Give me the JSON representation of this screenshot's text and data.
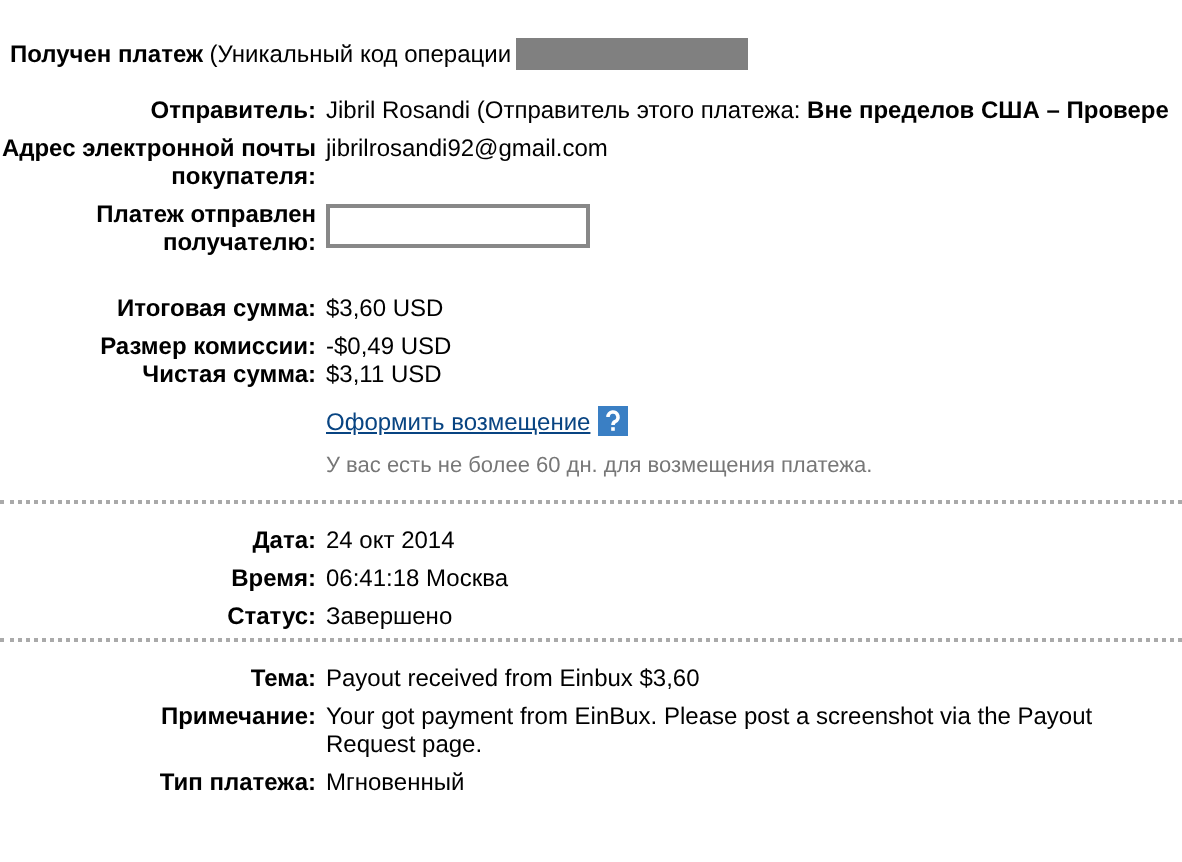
{
  "header": {
    "title": "**Получен платеж** (Уникальный код операции"
  },
  "sections": [
    {
      "rows": [
        {
          "kind": "text",
          "label": "Отправитель:",
          "value": "Jibril Rosandi (Отправитель этого платежа: **Вне пределов США – Провере**"
        },
        {
          "kind": "text",
          "label": "Адрес электронной почты покупателя:",
          "value": "jibrilrosandi92@gmail.com"
        },
        {
          "kind": "redacted",
          "label": "Платеж отправлен получателю:"
        },
        {
          "kind": "gap"
        },
        {
          "kind": "text",
          "label": "Итоговая сумма:",
          "value": "$3,60 USD"
        },
        {
          "kind": "text",
          "label": "Размер комиссии:",
          "value": "-$0,49 USD"
        },
        {
          "kind": "text",
          "label": "Чистая сумма:",
          "value": "$3,11 USD"
        },
        {
          "kind": "link",
          "value": "Оформить возмещение",
          "note": "У вас есть не более 60 дн. для возмещения платежа."
        }
      ]
    },
    {
      "rows": [
        {
          "kind": "text",
          "label": "Дата:",
          "value": "24 окт 2014"
        },
        {
          "kind": "text",
          "label": "Время:",
          "value": "06:41:18 Москва"
        },
        {
          "kind": "text",
          "label": "Статус:",
          "value": "Завершено"
        }
      ]
    },
    {
      "rows": [
        {
          "kind": "text",
          "label": "Тема:",
          "value": "Payout received from Einbux $3,60"
        },
        {
          "kind": "text",
          "label": "Примечание:",
          "value": "Your got payment from EinBux. Please post a screenshot via the Payout Request page."
        },
        {
          "kind": "text",
          "label": "Тип платежа:",
          "value": "Мгновенный"
        }
      ]
    }
  ]
}
